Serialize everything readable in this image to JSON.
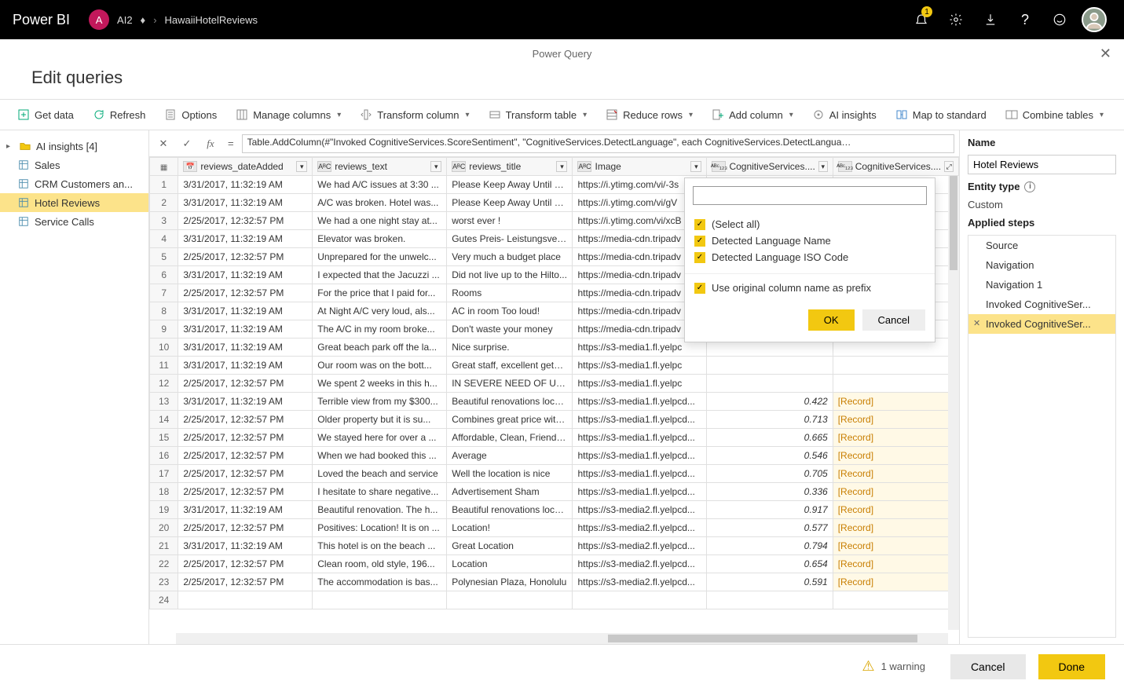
{
  "topbar": {
    "product": "Power BI",
    "workspace_initial": "A",
    "workspace": "AI2",
    "report": "HawaiiHotelReviews",
    "notification_count": "1"
  },
  "pq_header": {
    "title": "Power Query"
  },
  "page_title": "Edit queries",
  "toolbar": {
    "get_data": "Get data",
    "refresh": "Refresh",
    "options": "Options",
    "manage_columns": "Manage columns",
    "transform_column": "Transform column",
    "transform_table": "Transform table",
    "reduce_rows": "Reduce rows",
    "add_column": "Add column",
    "ai_insights": "AI insights",
    "map_to_standard": "Map to standard",
    "combine_tables": "Combine tables"
  },
  "leftnav": {
    "folder": "AI insights  [4]",
    "items": [
      "Sales",
      "CRM Customers an...",
      "Hotel Reviews",
      "Service Calls"
    ],
    "selected": "Hotel Reviews"
  },
  "formula": "Table.AddColumn(#\"Invoked CognitiveServices.ScoreSentiment\", \"CognitiveServices.DetectLanguage\", each CognitiveServices.DetectLangua…",
  "columns": [
    {
      "key": "dateAdded",
      "label": "reviews_dateAdded",
      "dtype": "date"
    },
    {
      "key": "text",
      "label": "reviews_text",
      "dtype": "abc"
    },
    {
      "key": "title",
      "label": "reviews_title",
      "dtype": "abc"
    },
    {
      "key": "image",
      "label": "Image",
      "dtype": "abc"
    },
    {
      "key": "score",
      "label": "CognitiveServices....",
      "dtype": "any"
    },
    {
      "key": "lang",
      "label": "CognitiveServices....",
      "dtype": "any",
      "expand": true
    }
  ],
  "rows": [
    {
      "n": 1,
      "dateAdded": "3/31/2017, 11:32:19 AM",
      "text": "We had A/C issues at 3:30 ...",
      "title": "Please Keep Away Until Co...",
      "image": "https://i.ytimg.com/vi/-3s",
      "score": "",
      "lang": ""
    },
    {
      "n": 2,
      "dateAdded": "3/31/2017, 11:32:19 AM",
      "text": "A/C was broken. Hotel was...",
      "title": "Please Keep Away Until Co...",
      "image": "https://i.ytimg.com/vi/gV",
      "score": "",
      "lang": ""
    },
    {
      "n": 3,
      "dateAdded": "2/25/2017, 12:32:57 PM",
      "text": "We had a one night stay at...",
      "title": "worst ever !",
      "image": "https://i.ytimg.com/vi/xcB",
      "score": "",
      "lang": ""
    },
    {
      "n": 4,
      "dateAdded": "3/31/2017, 11:32:19 AM",
      "text": "Elevator was broken.",
      "title": "Gutes Preis- Leistungsverh...",
      "image": "https://media-cdn.tripadv",
      "score": "",
      "lang": ""
    },
    {
      "n": 5,
      "dateAdded": "2/25/2017, 12:32:57 PM",
      "text": "Unprepared for the unwelc...",
      "title": "Very much a budget place",
      "image": "https://media-cdn.tripadv",
      "score": "",
      "lang": ""
    },
    {
      "n": 6,
      "dateAdded": "3/31/2017, 11:32:19 AM",
      "text": "I expected that the Jacuzzi ...",
      "title": "Did not live up to the Hilto...",
      "image": "https://media-cdn.tripadv",
      "score": "",
      "lang": ""
    },
    {
      "n": 7,
      "dateAdded": "2/25/2017, 12:32:57 PM",
      "text": "For the price that I paid for...",
      "title": "Rooms",
      "image": "https://media-cdn.tripadv",
      "score": "",
      "lang": ""
    },
    {
      "n": 8,
      "dateAdded": "3/31/2017, 11:32:19 AM",
      "text": "At Night A/C very loud, als...",
      "title": "AC in room Too loud!",
      "image": "https://media-cdn.tripadv",
      "score": "",
      "lang": ""
    },
    {
      "n": 9,
      "dateAdded": "3/31/2017, 11:32:19 AM",
      "text": "The A/C in my room broke...",
      "title": "Don't waste your money",
      "image": "https://media-cdn.tripadv",
      "score": "",
      "lang": ""
    },
    {
      "n": 10,
      "dateAdded": "3/31/2017, 11:32:19 AM",
      "text": "Great beach park off the la...",
      "title": "Nice surprise.",
      "image": "https://s3-media1.fl.yelpc",
      "score": "",
      "lang": ""
    },
    {
      "n": 11,
      "dateAdded": "3/31/2017, 11:32:19 AM",
      "text": "Our room was on the bott...",
      "title": "Great staff, excellent getaw...",
      "image": "https://s3-media1.fl.yelpc",
      "score": "",
      "lang": ""
    },
    {
      "n": 12,
      "dateAdded": "2/25/2017, 12:32:57 PM",
      "text": "We spent 2 weeks in this h...",
      "title": "IN SEVERE NEED OF UPDA...",
      "image": "https://s3-media1.fl.yelpc",
      "score": "",
      "lang": ""
    },
    {
      "n": 13,
      "dateAdded": "3/31/2017, 11:32:19 AM",
      "text": "Terrible view from my $300...",
      "title": "Beautiful renovations locat...",
      "image": "https://s3-media1.fl.yelpcd...",
      "score": "0.422",
      "lang": "[Record]"
    },
    {
      "n": 14,
      "dateAdded": "2/25/2017, 12:32:57 PM",
      "text": "Older property but it is su...",
      "title": "Combines great price with ...",
      "image": "https://s3-media1.fl.yelpcd...",
      "score": "0.713",
      "lang": "[Record]"
    },
    {
      "n": 15,
      "dateAdded": "2/25/2017, 12:32:57 PM",
      "text": "We stayed here for over a ...",
      "title": "Affordable, Clean, Friendly ...",
      "image": "https://s3-media1.fl.yelpcd...",
      "score": "0.665",
      "lang": "[Record]"
    },
    {
      "n": 16,
      "dateAdded": "2/25/2017, 12:32:57 PM",
      "text": "When we had booked this ...",
      "title": "Average",
      "image": "https://s3-media1.fl.yelpcd...",
      "score": "0.546",
      "lang": "[Record]"
    },
    {
      "n": 17,
      "dateAdded": "2/25/2017, 12:32:57 PM",
      "text": "Loved the beach and service",
      "title": "Well the location is nice",
      "image": "https://s3-media1.fl.yelpcd...",
      "score": "0.705",
      "lang": "[Record]"
    },
    {
      "n": 18,
      "dateAdded": "2/25/2017, 12:32:57 PM",
      "text": "I hesitate to share negative...",
      "title": "Advertisement Sham",
      "image": "https://s3-media1.fl.yelpcd...",
      "score": "0.336",
      "lang": "[Record]"
    },
    {
      "n": 19,
      "dateAdded": "3/31/2017, 11:32:19 AM",
      "text": "Beautiful renovation. The h...",
      "title": "Beautiful renovations locat...",
      "image": "https://s3-media2.fl.yelpcd...",
      "score": "0.917",
      "lang": "[Record]"
    },
    {
      "n": 20,
      "dateAdded": "2/25/2017, 12:32:57 PM",
      "text": "Positives: Location! It is on ...",
      "title": "Location!",
      "image": "https://s3-media2.fl.yelpcd...",
      "score": "0.577",
      "lang": "[Record]"
    },
    {
      "n": 21,
      "dateAdded": "3/31/2017, 11:32:19 AM",
      "text": "This hotel is on the beach ...",
      "title": "Great Location",
      "image": "https://s3-media2.fl.yelpcd...",
      "score": "0.794",
      "lang": "[Record]"
    },
    {
      "n": 22,
      "dateAdded": "2/25/2017, 12:32:57 PM",
      "text": "Clean room, old style, 196...",
      "title": "Location",
      "image": "https://s3-media2.fl.yelpcd...",
      "score": "0.654",
      "lang": "[Record]"
    },
    {
      "n": 23,
      "dateAdded": "2/25/2017, 12:32:57 PM",
      "text": "The accommodation is bas...",
      "title": "Polynesian Plaza, Honolulu",
      "image": "https://s3-media2.fl.yelpcd...",
      "score": "0.591",
      "lang": "[Record]"
    }
  ],
  "popup": {
    "select_all": "(Select all)",
    "opt1": "Detected Language Name",
    "opt2": "Detected Language ISO Code",
    "prefix": "Use original column name as prefix",
    "ok": "OK",
    "cancel": "Cancel"
  },
  "right": {
    "name_label": "Name",
    "name_value": "Hotel Reviews",
    "entity_type_label": "Entity type",
    "entity_type_value": "Custom",
    "applied_steps_label": "Applied steps",
    "steps": [
      "Source",
      "Navigation",
      "Navigation 1",
      "Invoked CognitiveSer...",
      "Invoked CognitiveSer..."
    ],
    "selected_step": 4
  },
  "footer": {
    "warning": "1 warning",
    "cancel": "Cancel",
    "done": "Done"
  }
}
